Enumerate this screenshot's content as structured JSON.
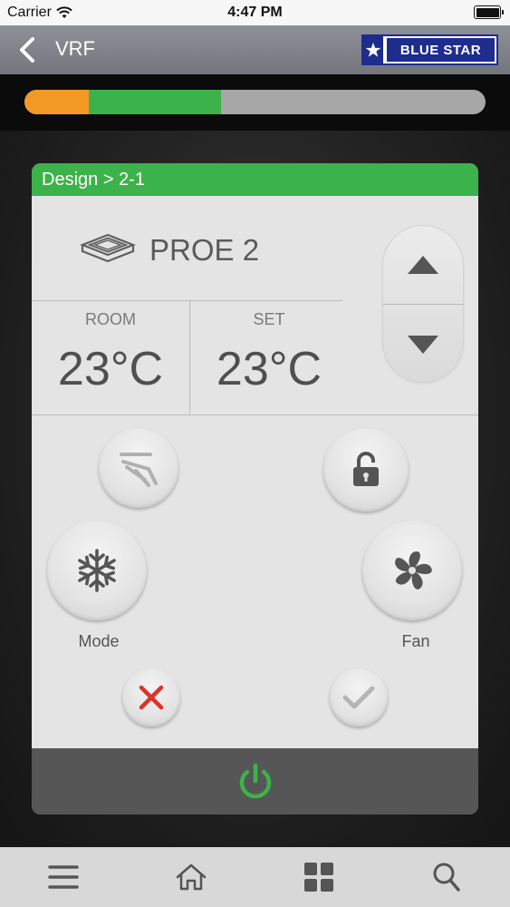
{
  "status_bar": {
    "carrier": "Carrier",
    "time": "4:47 PM"
  },
  "nav": {
    "title": "VRF",
    "brand": "BLUE STAR"
  },
  "progress": {
    "orange_fraction": 0.14,
    "green_fraction": 0.286
  },
  "card": {
    "breadcrumb": "Design > 2-1",
    "unit_name": "PROE 2",
    "room_label": "ROOM",
    "room_temp": "23°C",
    "set_label": "SET",
    "set_temp": "23°C",
    "mode_label": "Mode",
    "fan_label": "Fan"
  },
  "colors": {
    "accent_green": "#3cb24a",
    "progress_orange": "#f39a25",
    "cancel_red": "#e0312a"
  },
  "icons": [
    "back-chevron-icon",
    "cassette-unit-icon",
    "swing-icon",
    "unlock-icon",
    "snowflake-icon",
    "fan-icon",
    "cancel-icon",
    "check-icon",
    "power-icon",
    "menu-icon",
    "home-icon",
    "grid-icon",
    "search-icon"
  ]
}
